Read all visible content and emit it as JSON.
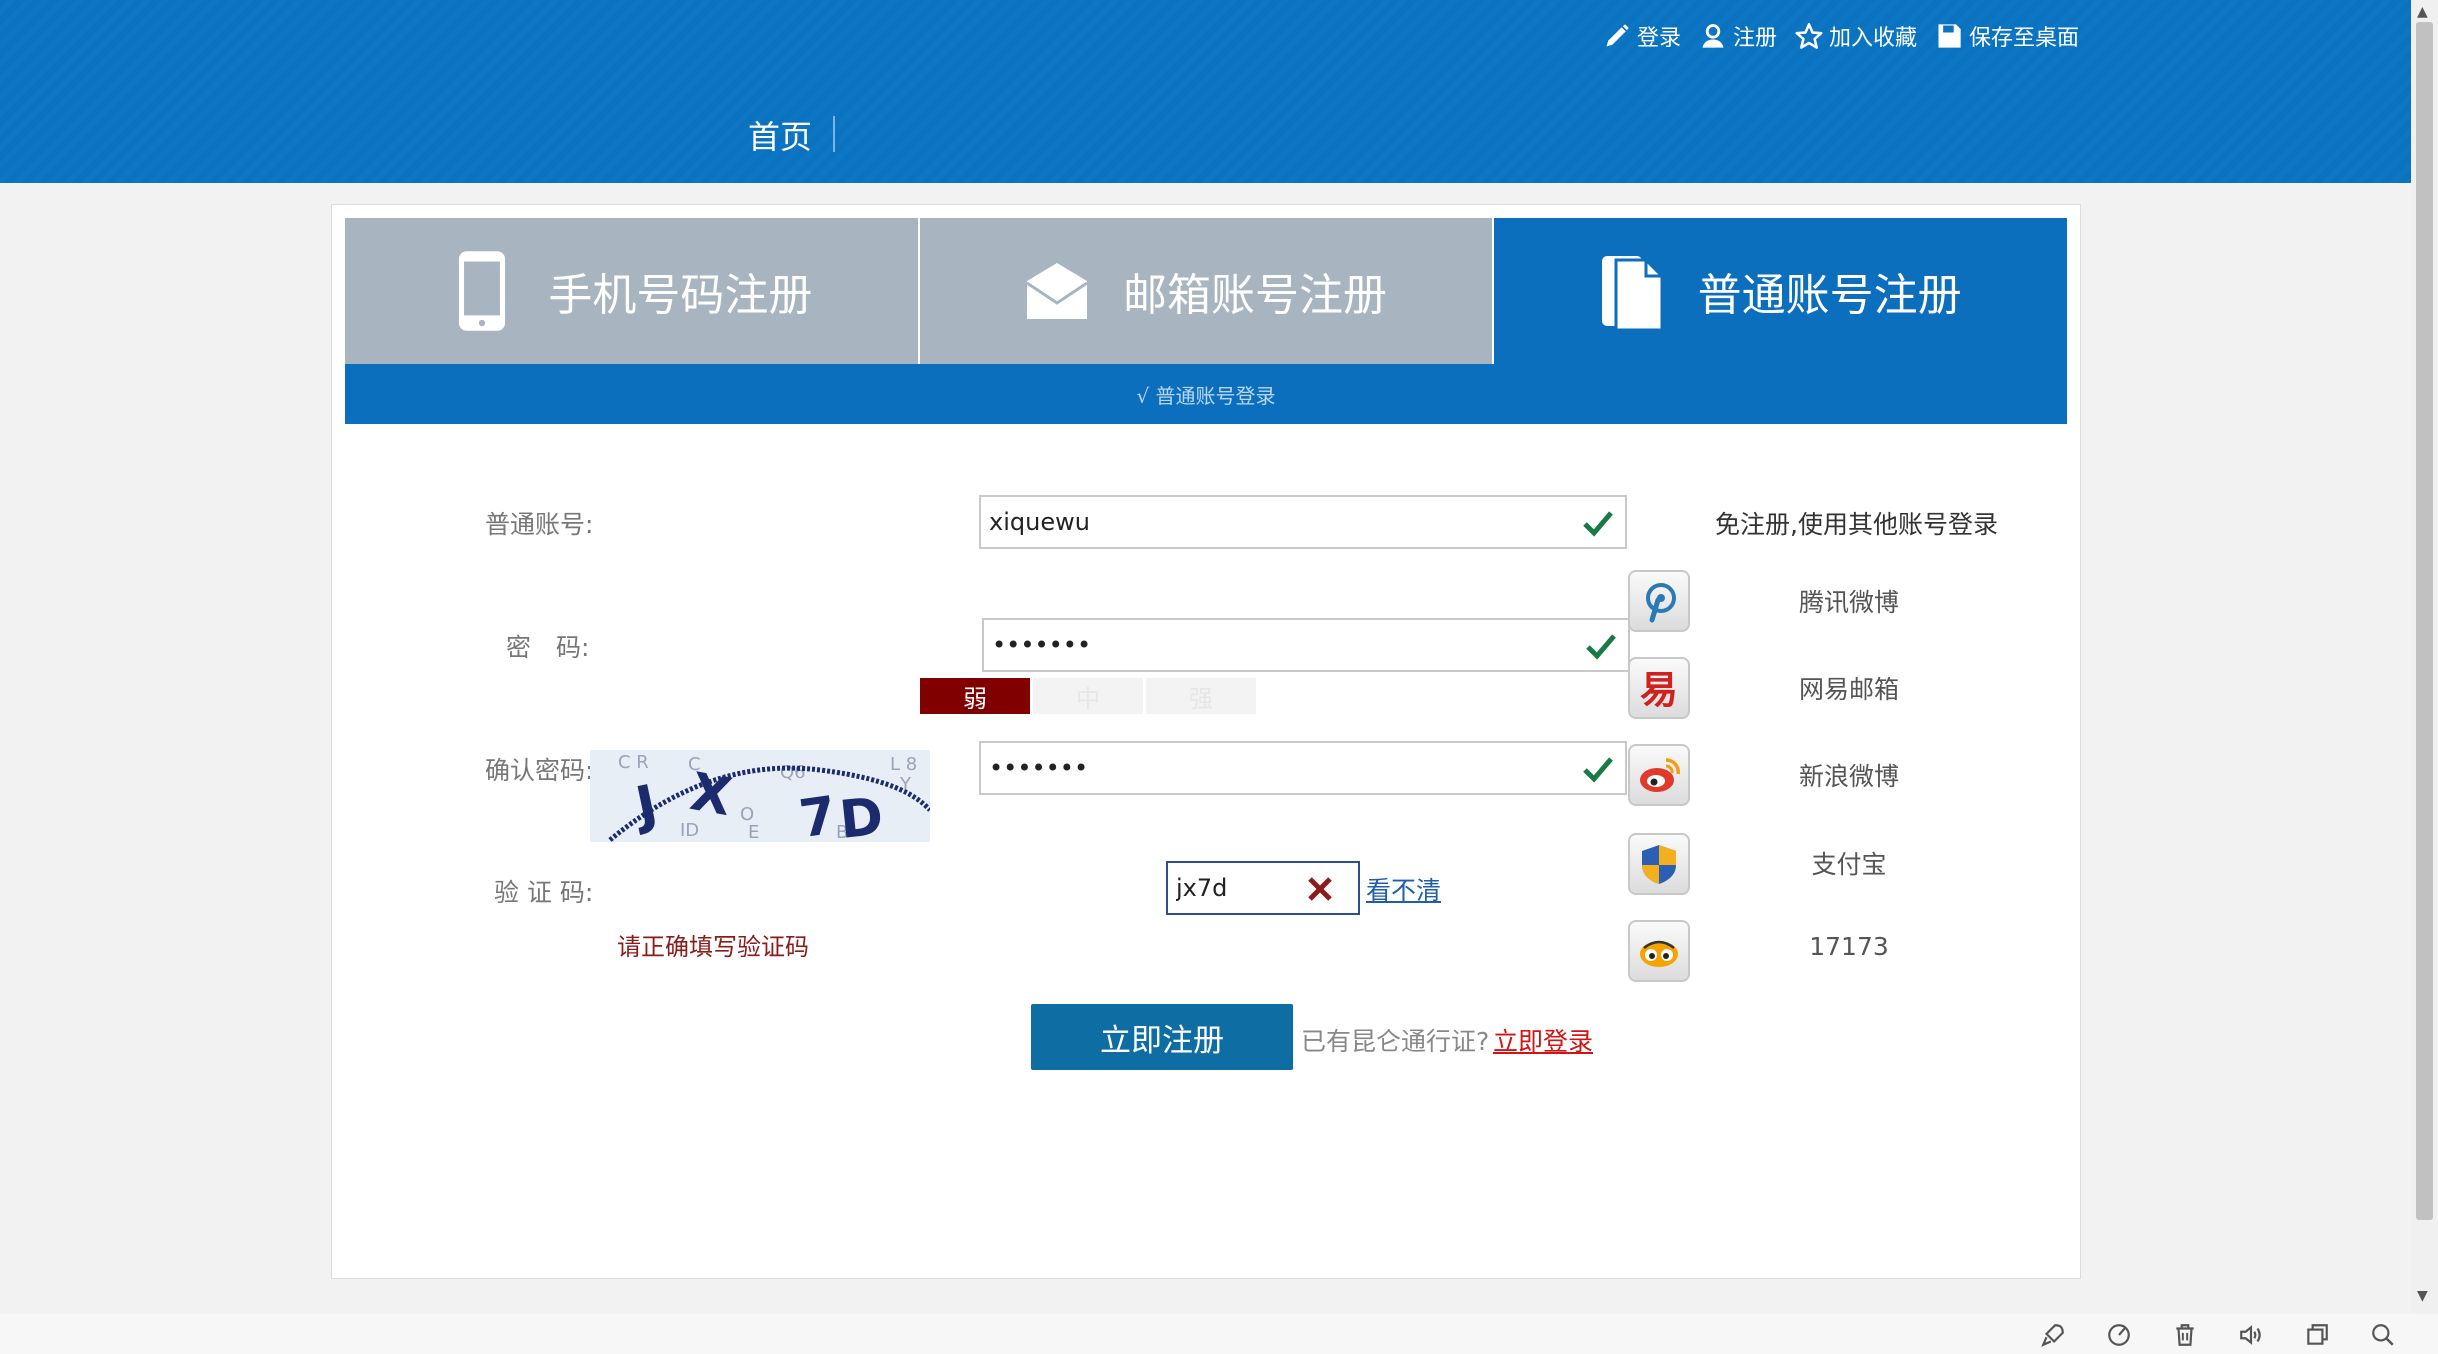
{
  "header": {
    "links": [
      {
        "label": "登录",
        "icon": "pencil-icon"
      },
      {
        "label": "注册",
        "icon": "user-icon"
      },
      {
        "label": "加入收藏",
        "icon": "star-icon"
      },
      {
        "label": "保存至桌面",
        "icon": "save-icon"
      }
    ],
    "nav_home": "首页"
  },
  "tabs": [
    {
      "label": "手机号码注册",
      "icon": "mobile-phone-icon",
      "active": false
    },
    {
      "label": "邮箱账号注册",
      "icon": "envelope-icon",
      "active": false
    },
    {
      "label": "普通账号注册",
      "icon": "document-icon",
      "active": true
    }
  ],
  "subbar_text": "√ 普通账号登录",
  "form": {
    "account_label": "普通账号:",
    "account_value": "xiquewu",
    "password_label": "密　码:",
    "password_value": "•••••••",
    "strength": {
      "weak": "弱",
      "medium": "中",
      "strong": "强",
      "level": "weak"
    },
    "confirm_label": "确认密码:",
    "confirm_value": "•••••••",
    "captcha_label": "验 证 码:",
    "captcha_value": "jx7d",
    "captcha_refresh": "看不清",
    "error_text": "请正确填写验证码",
    "submit_label": "立即注册",
    "have_account_text": "已有昆仑通行证?",
    "login_link": "立即登录"
  },
  "social": {
    "title": "免注册,使用其他账号登录",
    "providers": [
      {
        "name": "腾讯微博",
        "icon": "tencent-weibo-icon"
      },
      {
        "name": "网易邮箱",
        "icon": "netease-mail-icon"
      },
      {
        "name": "新浪微博",
        "icon": "sina-weibo-icon"
      },
      {
        "name": "支付宝",
        "icon": "alipay-shield-icon"
      },
      {
        "name": "17173",
        "icon": "17173-icon"
      }
    ]
  },
  "colors": {
    "header_blue": "#0a72bf",
    "tab_active": "#0b6fbd",
    "tab_inactive": "#a8b4c0",
    "check_green": "#1a7a45",
    "weak_red": "#800000",
    "error_red": "#8b1c1c",
    "submit_blue": "#0e6ea4"
  },
  "bottom_toolbar": [
    "rocket-icon",
    "speed-icon",
    "trash-icon",
    "speaker-icon",
    "window-icon",
    "search-icon"
  ]
}
